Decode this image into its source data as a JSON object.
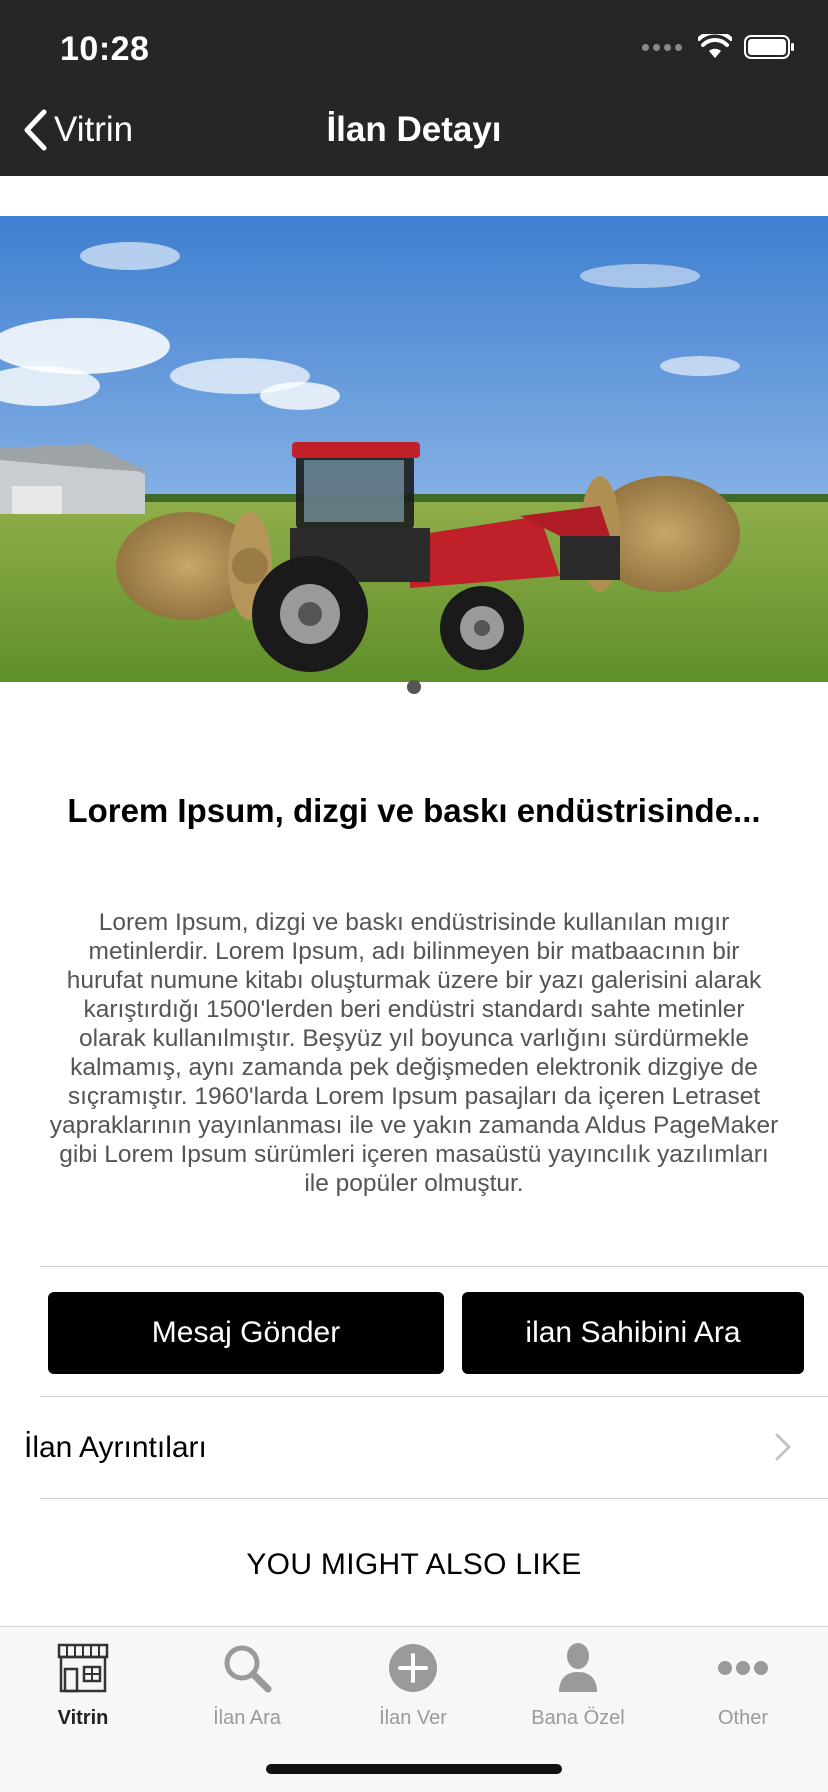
{
  "status_bar": {
    "time": "10:28"
  },
  "nav": {
    "back_label": "Vitrin",
    "title": "İlan Detayı"
  },
  "listing": {
    "title": "Lorem Ipsum, dizgi ve baskı endüstrisinde...",
    "description": "Lorem Ipsum, dizgi ve baskı endüstrisinde kullanılan mıgır metinlerdir. Lorem Ipsum, adı bilinmeyen bir matbaacının bir hurufat numune kitabı oluşturmak üzere bir yazı galerisini alarak karıştırdığı 1500'lerden beri endüstri standardı sahte metinler olarak kullanılmıştır. Beşyüz yıl boyunca varlığını sürdürmekle kalmamış, aynı zamanda pek değişmeden elektronik dizgiye de sıçramıştır. 1960'larda Lorem Ipsum pasajları da içeren Letraset yapraklarının yayınlanması ile ve yakın zamanda Aldus PageMaker gibi Lorem Ipsum sürümleri içeren masaüstü yayıncılık yazılımları ile popüler olmuştur."
  },
  "actions": {
    "message_label": "Mesaj Gönder",
    "call_label": "ilan Sahibini Ara"
  },
  "details_label": "İlan Ayrıntıları",
  "also_like_label": "YOU MIGHT ALSO LIKE",
  "tabs": [
    {
      "label": "Vitrin",
      "icon": "storefront-icon",
      "active": true
    },
    {
      "label": "İlan Ara",
      "icon": "search-icon",
      "active": false
    },
    {
      "label": "İlan Ver",
      "icon": "plus-circle-icon",
      "active": false
    },
    {
      "label": "Bana Özel",
      "icon": "person-icon",
      "active": false
    },
    {
      "label": "Other",
      "icon": "more-icon",
      "active": false
    }
  ]
}
